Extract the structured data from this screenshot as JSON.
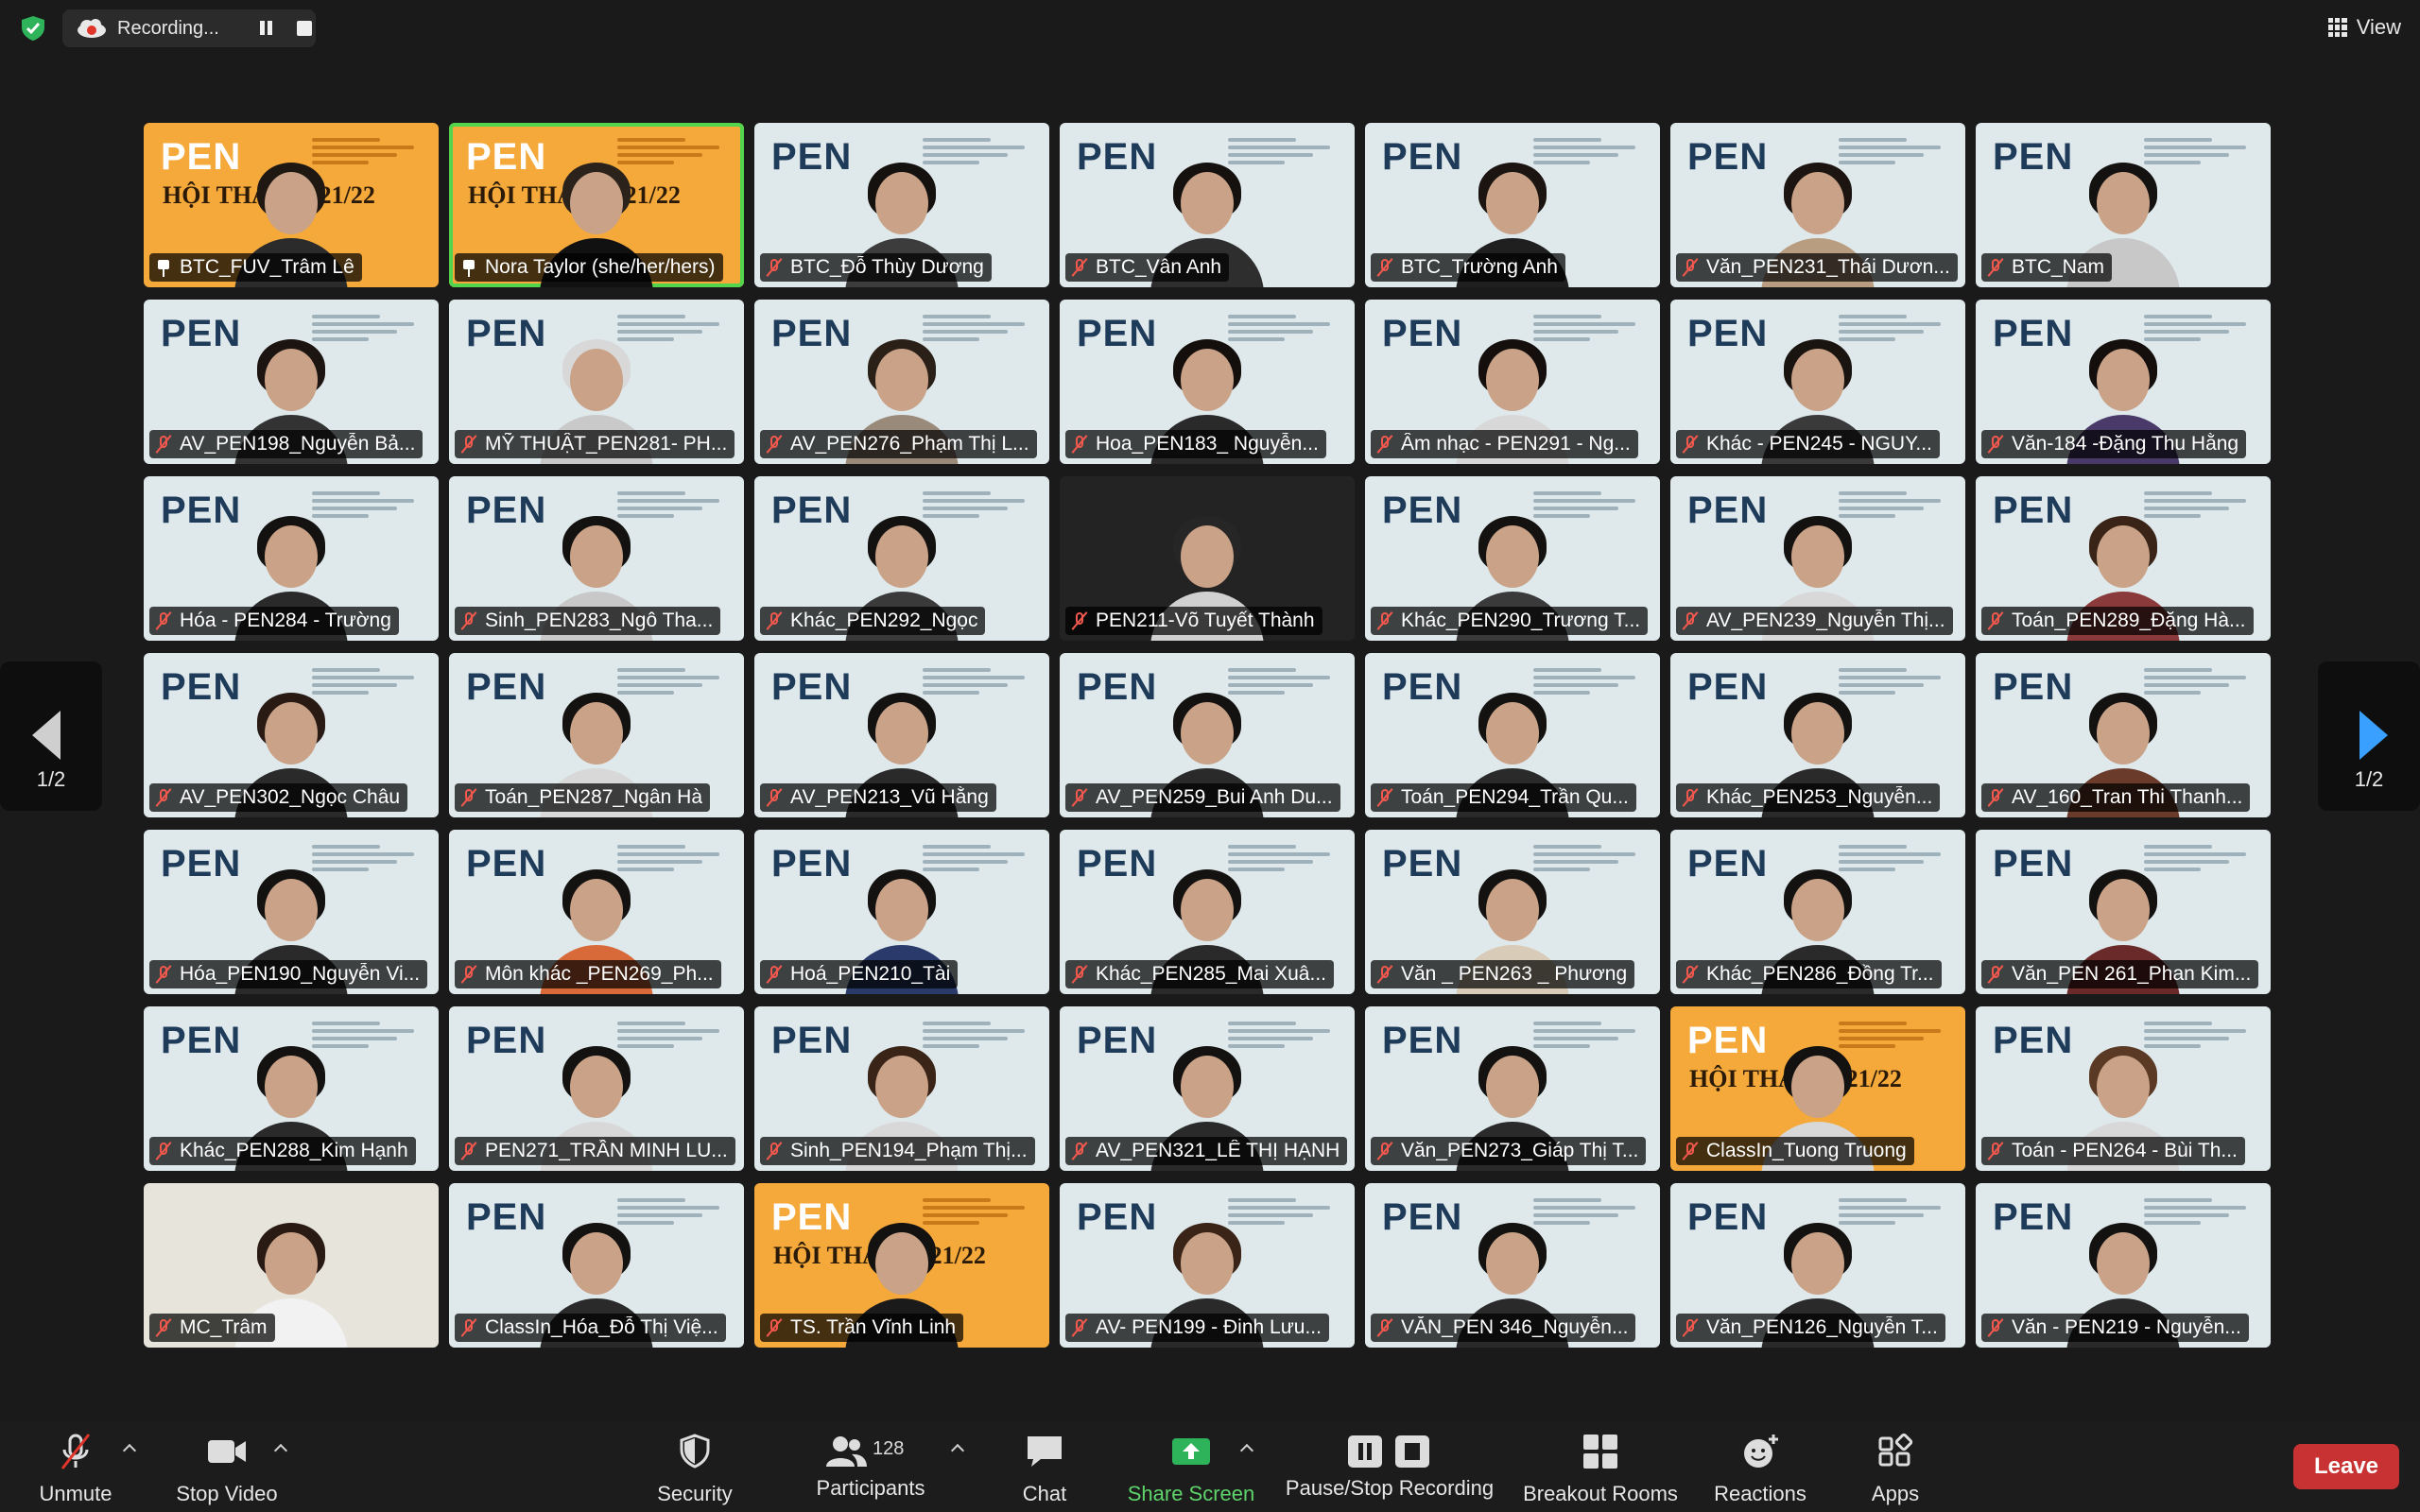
{
  "recording": {
    "label": "Recording..."
  },
  "view": {
    "label": "View"
  },
  "pagination": {
    "left": "1/2",
    "right": "1/2"
  },
  "participants": [
    {
      "name": "BTC_FUV_Trâm Lê",
      "bg": "yellow",
      "icon": "pin-icon",
      "hair": "#1e1712",
      "shirt": "#2b2b2b",
      "logo": true
    },
    {
      "name": "Nora Taylor (she/her/hers)",
      "bg": "yellow",
      "icon": "pin-icon",
      "active": true,
      "hair": "#2b231b",
      "shirt": "#111111",
      "logo": true
    },
    {
      "name": "BTC_Đỗ Thùy Dương",
      "bg": "light",
      "icon": "mic-muted-icon",
      "hair": "#15110e",
      "shirt": "#3c3c3c",
      "logo": true
    },
    {
      "name": "BTC_Vân Anh",
      "bg": "light",
      "icon": "mic-muted-icon",
      "hair": "#15110e",
      "shirt": "#2e2e2e",
      "logo": true
    },
    {
      "name": "BTC_Trường Anh",
      "bg": "light",
      "icon": "mic-muted-icon",
      "hair": "#1b1410",
      "shirt": "#1f1f1f",
      "logo": true
    },
    {
      "name": "Văn_PEN231_Thái Dươn...",
      "bg": "light",
      "icon": "mic-muted-icon",
      "hair": "#1b1410",
      "shirt": "#b99d80",
      "logo": true
    },
    {
      "name": "BTC_Nam",
      "bg": "light",
      "icon": "mic-muted-icon",
      "hair": "#141210",
      "shirt": "#c8c8c8",
      "logo": true
    },
    {
      "name": "AV_PEN198_Nguyễn Bả...",
      "bg": "light",
      "icon": "mic-muted-icon",
      "hair": "#1c1410",
      "shirt": "#333333",
      "logo": true
    },
    {
      "name": "MỸ THUẬT_PEN281- PH...",
      "bg": "light",
      "icon": "mic-muted-icon",
      "hair": "#d8d8d8",
      "shirt": "#c9c9c9",
      "logo": true
    },
    {
      "name": "AV_PEN276_Phạm Thị L...",
      "bg": "light",
      "icon": "mic-muted-icon",
      "hair": "#2a2018",
      "shirt": "#9a8a7a",
      "logo": true
    },
    {
      "name": "Hoa_PEN183_ Nguyễn...",
      "bg": "light",
      "icon": "mic-muted-icon",
      "hair": "#140f0c",
      "shirt": "#2a2a2a",
      "logo": true
    },
    {
      "name": "Âm nhạc - PEN291 - Ng...",
      "bg": "light",
      "icon": "mic-muted-icon",
      "hair": "#140f0c",
      "shirt": "#d8d8d8",
      "logo": true
    },
    {
      "name": "Khác - PEN245 - NGUY...",
      "bg": "light",
      "icon": "mic-muted-icon",
      "hair": "#1a1410",
      "shirt": "#3a3a3a",
      "logo": true
    },
    {
      "name": "Văn-184 -Đặng Thu Hằng",
      "bg": "light",
      "icon": "mic-muted-icon",
      "hair": "#140f0c",
      "shirt": "#4a3a6a",
      "logo": true
    },
    {
      "name": "Hóa - PEN284 - Trường",
      "bg": "light",
      "icon": "mic-muted-icon",
      "hair": "#141210",
      "shirt": "#2a2a2a",
      "logo": true
    },
    {
      "name": "Sinh_PEN283_Ngô Tha...",
      "bg": "light",
      "icon": "mic-muted-icon",
      "hair": "#141210",
      "shirt": "#c8c8c8",
      "logo": true
    },
    {
      "name": "Khác_PEN292_Ngọc",
      "bg": "light",
      "icon": "mic-muted-icon",
      "hair": "#141210",
      "shirt": "#3a3a3a",
      "logo": true
    },
    {
      "name": "PEN211-Võ Tuyết Thành",
      "bg": "dark",
      "icon": "mic-muted-icon",
      "hair": "#262626",
      "shirt": "#d0d0d0",
      "logo": false
    },
    {
      "name": "Khác_PEN290_Trương T...",
      "bg": "light",
      "icon": "mic-muted-icon",
      "hair": "#141210",
      "shirt": "#3a3a3a",
      "logo": true
    },
    {
      "name": "AV_PEN239_Nguyễn Thị...",
      "bg": "light",
      "icon": "mic-muted-icon",
      "hair": "#141210",
      "shirt": "#d8d8d8",
      "logo": true
    },
    {
      "name": "Toán_PEN289_Đặng Hà...",
      "bg": "light",
      "icon": "mic-muted-icon",
      "hair": "#3a2418",
      "shirt": "#8a3a3a",
      "logo": true
    },
    {
      "name": "AV_PEN302_Ngọc Châu",
      "bg": "light",
      "icon": "mic-muted-icon",
      "hair": "#2a1a14",
      "shirt": "#2a2a2a",
      "logo": true
    },
    {
      "name": "Toán_PEN287_Ngân Hà",
      "bg": "light",
      "icon": "mic-muted-icon",
      "hair": "#141210",
      "shirt": "#d8d8d8",
      "logo": true
    },
    {
      "name": "AV_PEN213_Vũ Hằng",
      "bg": "light",
      "icon": "mic-muted-icon",
      "hair": "#141210",
      "shirt": "#2a2a2a",
      "logo": true
    },
    {
      "name": "AV_PEN259_Bui Anh Du...",
      "bg": "light",
      "icon": "mic-muted-icon",
      "hair": "#141210",
      "shirt": "#2a2a2a",
      "logo": true
    },
    {
      "name": "Toán_PEN294_Trần Qu...",
      "bg": "light",
      "icon": "mic-muted-icon",
      "hair": "#141210",
      "shirt": "#2a2a2a",
      "logo": true
    },
    {
      "name": "Khác_PEN253_Nguyễn...",
      "bg": "light",
      "icon": "mic-muted-icon",
      "hair": "#141210",
      "shirt": "#2a2a2a",
      "logo": true
    },
    {
      "name": "AV_160_Tran Thi Thanh...",
      "bg": "light",
      "icon": "mic-muted-icon",
      "hair": "#141210",
      "shirt": "#6a3a2a",
      "logo": true
    },
    {
      "name": "Hóa_PEN190_Nguyễn Vi...",
      "bg": "light",
      "icon": "mic-muted-icon",
      "hair": "#141210",
      "shirt": "#2a2a2a",
      "logo": true
    },
    {
      "name": "Môn khác _PEN269_Ph...",
      "bg": "light",
      "icon": "mic-muted-icon",
      "hair": "#141210",
      "shirt": "#d86a3a",
      "logo": true
    },
    {
      "name": "Hoá_PEN210_Tài",
      "bg": "light",
      "icon": "mic-muted-icon",
      "hair": "#141210",
      "shirt": "#2a3a6a",
      "logo": true
    },
    {
      "name": "Khác_PEN285_Mai Xuâ...",
      "bg": "light",
      "icon": "mic-muted-icon",
      "hair": "#141210",
      "shirt": "#2a2a2a",
      "logo": true
    },
    {
      "name": "Văn _ PEN263 _ Phương",
      "bg": "light",
      "icon": "mic-muted-icon",
      "hair": "#141210",
      "shirt": "#d8cbb8",
      "logo": true
    },
    {
      "name": "Khác_PEN286_Đồng Tr...",
      "bg": "light",
      "icon": "mic-muted-icon",
      "hair": "#141210",
      "shirt": "#2a2a2a",
      "logo": true
    },
    {
      "name": "Văn_PEN 261_Phan Kim...",
      "bg": "light",
      "icon": "mic-muted-icon",
      "hair": "#141210",
      "shirt": "#6a2a2a",
      "logo": true
    },
    {
      "name": "Khác_PEN288_Kim Hạnh",
      "bg": "light",
      "icon": "mic-muted-icon",
      "hair": "#141210",
      "shirt": "#2a2a2a",
      "logo": true
    },
    {
      "name": "PEN271_TRẦN MINH LU...",
      "bg": "light",
      "icon": "mic-muted-icon",
      "hair": "#141210",
      "shirt": "#d8d8d8",
      "logo": true
    },
    {
      "name": "Sinh_PEN194_Phạm Thị...",
      "bg": "light",
      "icon": "mic-muted-icon",
      "hair": "#3a2418",
      "shirt": "#d8d8d8",
      "logo": true
    },
    {
      "name": "AV_PEN321_LÊ THỊ HẠNH",
      "bg": "light",
      "icon": "mic-muted-icon",
      "hair": "#141210",
      "shirt": "#2a2a2a",
      "logo": true
    },
    {
      "name": "Văn_PEN273_Giáp Thị T...",
      "bg": "light",
      "icon": "mic-muted-icon",
      "hair": "#141210",
      "shirt": "#2a2a2a",
      "logo": true
    },
    {
      "name": "ClassIn_Tuong Truong",
      "bg": "yellow",
      "icon": "mic-muted-icon",
      "hair": "#141210",
      "shirt": "#d8d8d8",
      "logo": true
    },
    {
      "name": "Toán - PEN264 - Bùi Th...",
      "bg": "light",
      "icon": "mic-muted-icon",
      "hair": "#5a3a24",
      "shirt": "#d8d8d8",
      "logo": true
    },
    {
      "name": "MC_Trâm",
      "bg": "photo",
      "icon": "mic-muted-icon",
      "hair": "#2a1a14",
      "shirt": "#f2f2f2",
      "logo": false
    },
    {
      "name": "ClassIn_Hóa_Đỗ Thị Việ...",
      "bg": "light",
      "icon": "mic-muted-icon",
      "hair": "#141210",
      "shirt": "#2a2a2a",
      "logo": true
    },
    {
      "name": "TS. Trần Vĩnh Linh",
      "bg": "yellow",
      "icon": "mic-muted-icon",
      "hair": "#141210",
      "shirt": "#1a1a1a",
      "logo": true
    },
    {
      "name": "AV- PEN199 - Đinh Lưu...",
      "bg": "light",
      "icon": "mic-muted-icon",
      "hair": "#3a2418",
      "shirt": "#2a2a2a",
      "logo": true
    },
    {
      "name": "VĂN_PEN 346_Nguyễn...",
      "bg": "light",
      "icon": "mic-muted-icon",
      "hair": "#141210",
      "shirt": "#2a2a2a",
      "logo": true
    },
    {
      "name": "Văn_PEN126_Nguyễn T...",
      "bg": "light",
      "icon": "mic-muted-icon",
      "hair": "#141210",
      "shirt": "#2a2a2a",
      "logo": true
    },
    {
      "name": "Văn - PEN219 - Nguyễn...",
      "bg": "light",
      "icon": "mic-muted-icon",
      "hair": "#141210",
      "shirt": "#2a2a2a",
      "logo": true
    }
  ],
  "logo_text": "PEN",
  "banner_text": {
    "left": "HỘI THẢO",
    "year": "2021/22"
  },
  "toolbar": {
    "unmute": "Unmute",
    "stop_video": "Stop Video",
    "security": "Security",
    "participants": "Participants",
    "participants_count": "128",
    "chat": "Chat",
    "share_screen": "Share Screen",
    "pause_stop_recording": "Pause/Stop Recording",
    "breakout_rooms": "Breakout Rooms",
    "reactions": "Reactions",
    "apps": "Apps",
    "leave": "Leave"
  },
  "colors": {
    "share_green": "#5fd36b",
    "leave_red": "#c83232",
    "active_speaker": "#52d44c"
  }
}
